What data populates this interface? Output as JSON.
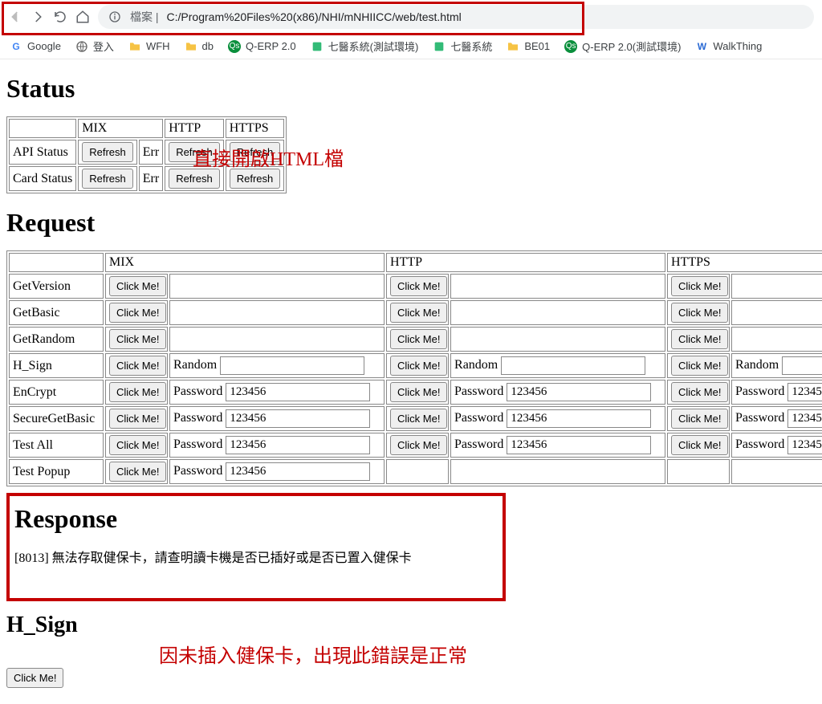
{
  "browser": {
    "address_label": "檔案",
    "url": "C:/Program%20Files%20(x86)/NHI/mNHIICC/web/test.html"
  },
  "bookmarks": [
    {
      "kind": "g",
      "label": "Google"
    },
    {
      "kind": "globe",
      "label": "登入"
    },
    {
      "kind": "folder",
      "label": "WFH"
    },
    {
      "kind": "folder",
      "label": "db"
    },
    {
      "kind": "qs",
      "label": "Q-ERP 2.0"
    },
    {
      "kind": "q7",
      "label": "七醫系統(測試環境)"
    },
    {
      "kind": "q7",
      "label": "七醫系統"
    },
    {
      "kind": "folder",
      "label": "BE01"
    },
    {
      "kind": "qs",
      "label": "Q-ERP 2.0(測試環境)"
    },
    {
      "kind": "w",
      "label": "WalkThing"
    }
  ],
  "annotations": {
    "top": "直接開啟HTML檔",
    "bottom": "因未插入健保卡，出現此錯誤是正常"
  },
  "sections": {
    "status": "Status",
    "request": "Request",
    "response": "Response",
    "hsign": "H_Sign"
  },
  "labels": {
    "refresh": "Refresh",
    "clickme": "Click Me!",
    "err": "Err",
    "random": "Random",
    "password": "Password",
    "mix": "MIX",
    "http": "HTTP",
    "https": "HTTPS"
  },
  "status_rows": [
    "API Status",
    "Card Status"
  ],
  "request_rows": [
    {
      "name": "GetVersion",
      "field": null,
      "value": "",
      "cols": [
        "mix",
        "http",
        "https"
      ]
    },
    {
      "name": "GetBasic",
      "field": null,
      "value": "",
      "cols": [
        "mix",
        "http",
        "https"
      ]
    },
    {
      "name": "GetRandom",
      "field": null,
      "value": "",
      "cols": [
        "mix",
        "http",
        "https"
      ]
    },
    {
      "name": "H_Sign",
      "field": "random",
      "value": "",
      "cols": [
        "mix",
        "http",
        "https"
      ]
    },
    {
      "name": "EnCrypt",
      "field": "password",
      "value": "123456",
      "cols": [
        "mix",
        "http",
        "https"
      ]
    },
    {
      "name": "SecureGetBasic",
      "field": "password",
      "value": "123456",
      "cols": [
        "mix",
        "http",
        "https"
      ]
    },
    {
      "name": "Test All",
      "field": "password",
      "value": "123456",
      "cols": [
        "mix",
        "http",
        "https"
      ]
    },
    {
      "name": "Test Popup",
      "field": "password",
      "value": "123456",
      "cols": [
        "mix"
      ]
    }
  ],
  "response_text": "[8013] 無法存取健保卡，請查明讀卡機是否已插好或是否已置入健保卡"
}
